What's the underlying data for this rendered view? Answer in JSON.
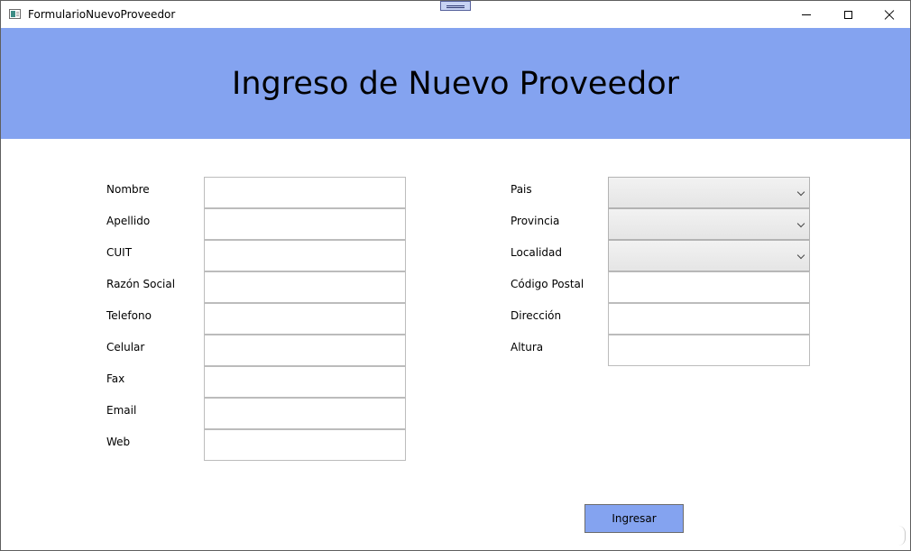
{
  "window": {
    "title": "FormularioNuevoProveedor",
    "app_icon": "form-app-icon",
    "controls": {
      "minimize_icon": "minimize-icon",
      "maximize_icon": "maximize-icon",
      "close_icon": "close-icon"
    }
  },
  "colors": {
    "header_band": "#84a3f0",
    "submit_button": "#84a3f0",
    "input_border": "#bcbcbc"
  },
  "header": {
    "title": "Ingreso de Nuevo Proveedor"
  },
  "left_fields": [
    {
      "label": "Nombre",
      "value": ""
    },
    {
      "label": "Apellido",
      "value": ""
    },
    {
      "label": "CUIT",
      "value": ""
    },
    {
      "label": "Razón Social",
      "value": ""
    },
    {
      "label": "Telefono",
      "value": ""
    },
    {
      "label": "Celular",
      "value": ""
    },
    {
      "label": "Fax",
      "value": ""
    },
    {
      "label": "Email",
      "value": ""
    },
    {
      "label": "Web",
      "value": ""
    }
  ],
  "right_fields": [
    {
      "label": "Pais",
      "type": "select",
      "value": "",
      "icon": "chevron-down-icon"
    },
    {
      "label": "Provincia",
      "type": "select",
      "value": "",
      "icon": "chevron-down-icon"
    },
    {
      "label": "Localidad",
      "type": "select",
      "value": "",
      "icon": "chevron-down-icon"
    },
    {
      "label": "Código Postal",
      "type": "text",
      "value": ""
    },
    {
      "label": "Dirección",
      "type": "text",
      "value": ""
    },
    {
      "label": "Altura",
      "type": "text",
      "value": ""
    }
  ],
  "submit": {
    "label": "Ingresar"
  }
}
